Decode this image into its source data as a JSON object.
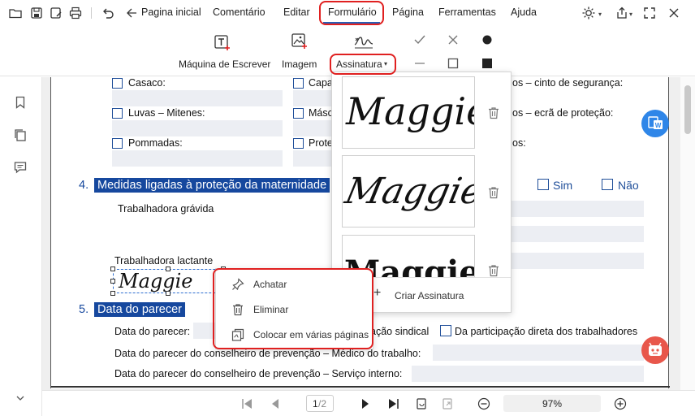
{
  "menu": {
    "home_label": "Pagina inicial",
    "items": [
      "Comentário",
      "Editar",
      "Formulário",
      "Página",
      "Ferramentas",
      "Ajuda"
    ]
  },
  "toolbar": {
    "typewriter_label": "Máquina de Escrever",
    "image_label": "Imagem",
    "signature_label": "Assinatura"
  },
  "document": {
    "checkbox_rows": [
      {
        "left": "Casaco:",
        "mid": "Capa",
        "right": "os – cinto de segurança:"
      },
      {
        "left": "Luvas – Mitenes:",
        "mid": "Másc",
        "right": "os – ecrã de proteção:"
      },
      {
        "left": "Pommadas:",
        "mid": "Prote",
        "right": "os:"
      }
    ],
    "section4": {
      "number": "4.",
      "title": "Medidas ligadas à proteção da maternidade",
      "yes": "Sim",
      "no": "Não"
    },
    "pregnant_label": "Trabalhadora grávida",
    "lactating_label": "Trabalhadora lactante",
    "section5": {
      "number": "5.",
      "title": "Data do parecer"
    },
    "date_label": "Data do parecer:",
    "union_text": "ação sindical",
    "direct_label": "Da participação direta dos trabalhadores",
    "occupational_label": "Data do parecer do conselheiro de prevenção – Médico do trabalho:",
    "internal_label": "Data do parecer do conselheiro de prevenção – Serviço interno:",
    "placed_signature": "Maggie"
  },
  "signature_panel": {
    "signatures": [
      "Maggie",
      "Maggie",
      "Maggie"
    ],
    "create_label": "Criar Assinatura"
  },
  "context_menu": {
    "items": [
      {
        "label": "Achatar",
        "icon": "flatten-icon"
      },
      {
        "label": "Eliminar",
        "icon": "trash-icon"
      },
      {
        "label": "Colocar em várias páginas",
        "icon": "place-multiple-icon"
      }
    ]
  },
  "pager": {
    "current": "1",
    "total": "/2",
    "zoom": "97%"
  },
  "colors": {
    "accent": "#16489e",
    "highlight_ring": "#e02020",
    "fab_blue": "#2f86e8",
    "fab_red": "#e8574b"
  }
}
